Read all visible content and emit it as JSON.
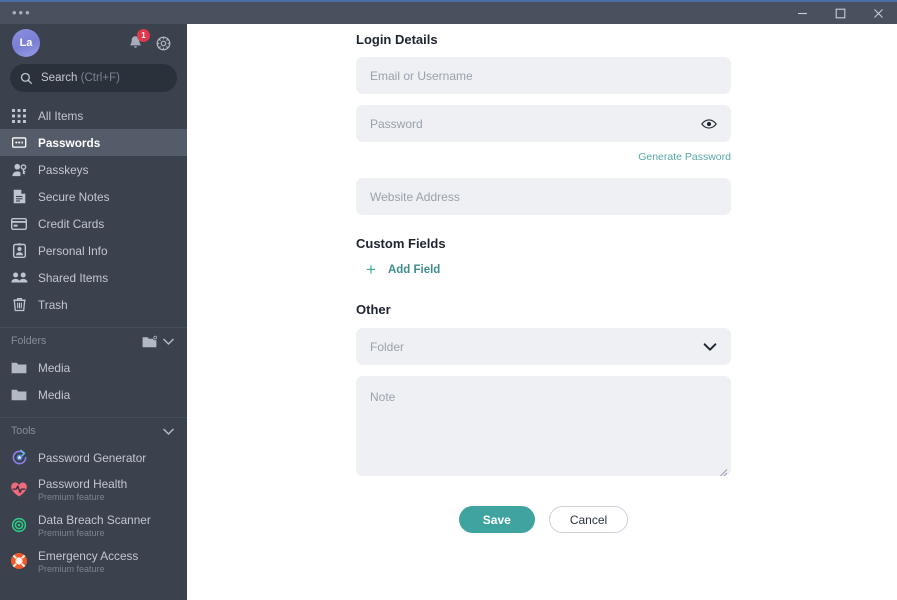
{
  "window": {
    "menu_dots": "•••",
    "minimize_label": "Minimize",
    "maximize_label": "Maximize",
    "close_label": "Close"
  },
  "sidebar": {
    "avatar_initials": "La",
    "notification_count": "1",
    "search": {
      "label": "Search",
      "shortcut": "(Ctrl+F)"
    },
    "nav": [
      {
        "label": "All Items",
        "icon": "grid-icon",
        "active": false
      },
      {
        "label": "Passwords",
        "icon": "password-icon",
        "active": true
      },
      {
        "label": "Passkeys",
        "icon": "passkey-icon",
        "active": false
      },
      {
        "label": "Secure Notes",
        "icon": "note-icon",
        "active": false
      },
      {
        "label": "Credit Cards",
        "icon": "credit-card-icon",
        "active": false
      },
      {
        "label": "Personal Info",
        "icon": "person-badge-icon",
        "active": false
      },
      {
        "label": "Shared Items",
        "icon": "people-icon",
        "active": false
      },
      {
        "label": "Trash",
        "icon": "trash-icon",
        "active": false
      }
    ],
    "folders_section": {
      "title": "Folders",
      "items": [
        {
          "label": "Media",
          "icon": "folder-icon"
        },
        {
          "label": "Media",
          "icon": "folder-icon"
        }
      ]
    },
    "tools_section": {
      "title": "Tools",
      "items": [
        {
          "label": "Password Generator",
          "sub": "",
          "icon": "generator-icon"
        },
        {
          "label": "Password Health",
          "sub": "Premium feature",
          "icon": "heart-pulse-icon"
        },
        {
          "label": "Data Breach Scanner",
          "sub": "Premium feature",
          "icon": "target-icon"
        },
        {
          "label": "Emergency Access",
          "sub": "Premium feature",
          "icon": "lifebuoy-icon"
        }
      ]
    }
  },
  "form": {
    "login_details_title": "Login Details",
    "username_placeholder": "Email or Username",
    "username_value": "",
    "password_placeholder": "Password",
    "password_value": "",
    "generate_password_link": "Generate Password",
    "website_placeholder": "Website Address",
    "website_value": "",
    "custom_fields_title": "Custom Fields",
    "add_field_label": "Add Field",
    "add_field_plus": "+",
    "other_title": "Other",
    "folder_placeholder": "Folder",
    "folder_value": "",
    "note_placeholder": "Note",
    "note_value": "",
    "save_label": "Save",
    "cancel_label": "Cancel"
  },
  "colors": {
    "accent_teal": "#3fa4a0",
    "link_teal": "#5aa7a7",
    "sidebar_bg": "#3b414d",
    "titlebar_bg": "#4a515e",
    "field_bg": "#eef0f4",
    "badge_red": "#e0374a",
    "top_accent": "#4a6fa5"
  }
}
